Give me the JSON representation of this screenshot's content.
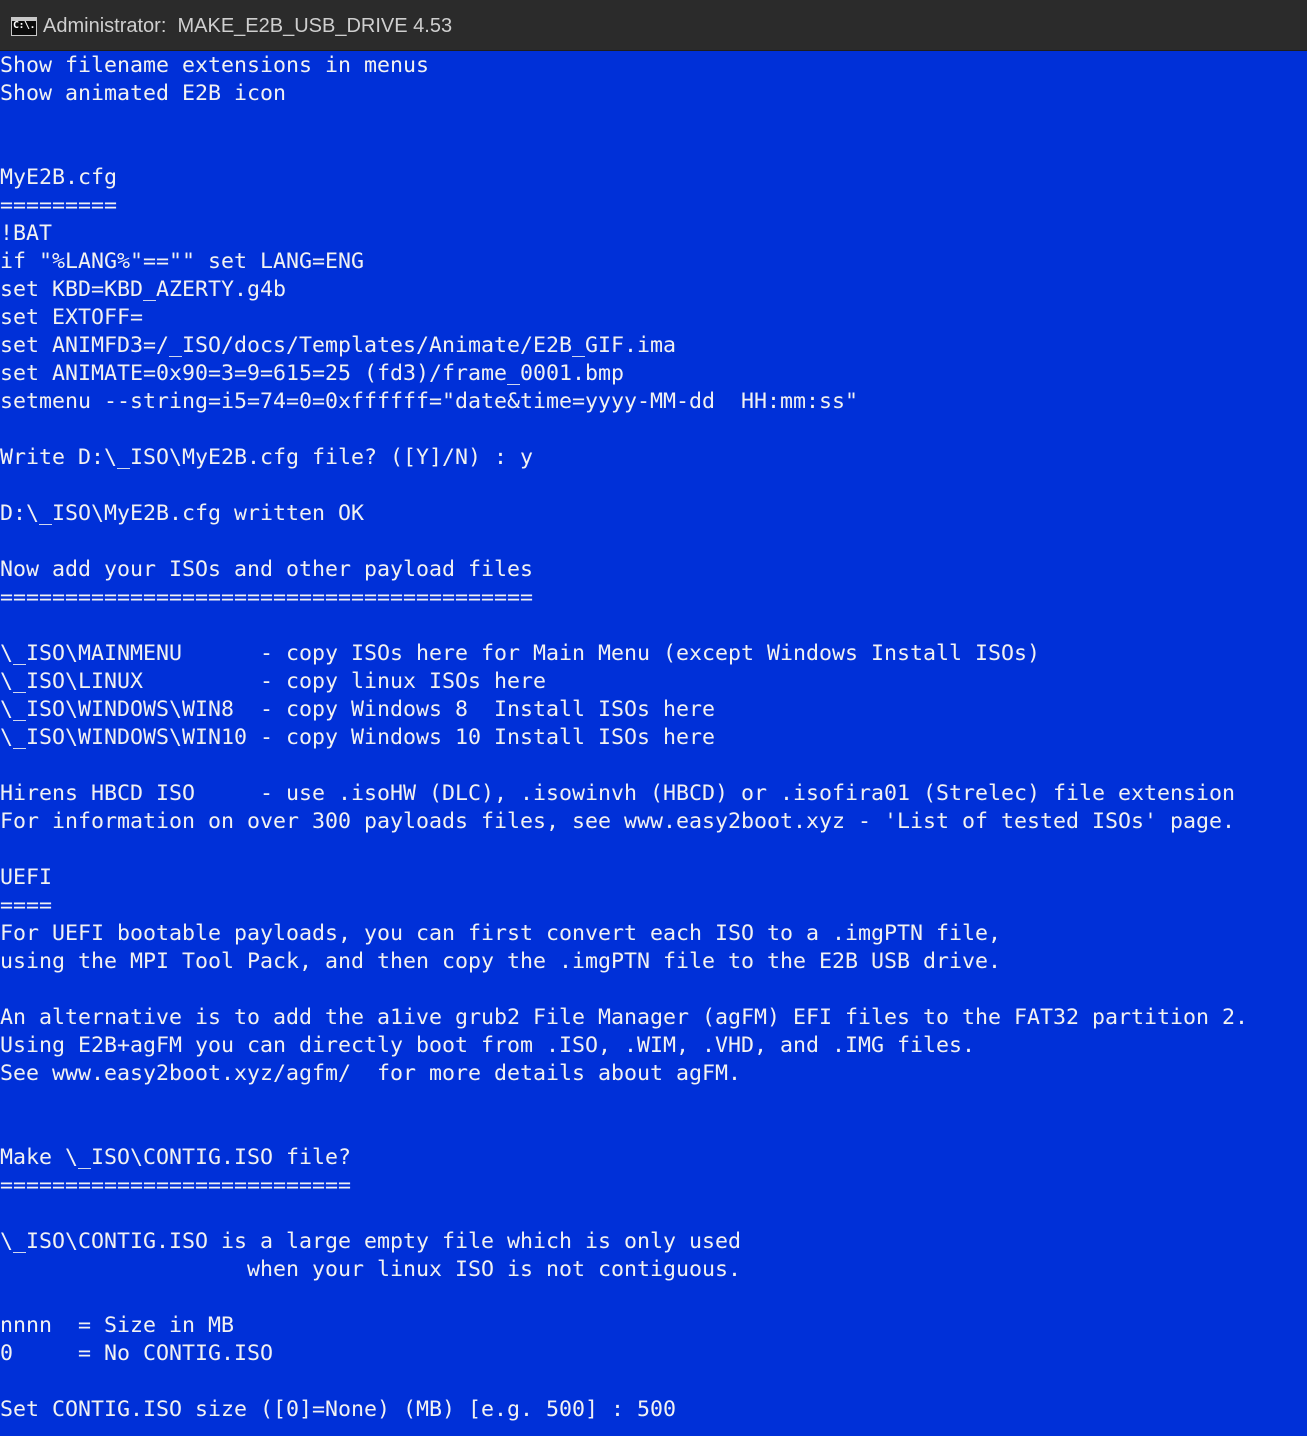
{
  "window": {
    "title": "Administrator:  MAKE_E2B_USB_DRIVE 4.53",
    "icon": "cmd-icon",
    "icon_text": "C:\\."
  },
  "colors": {
    "background": "#0030d8",
    "text": "#f2f2f2",
    "titlebar": "#2b2b2b"
  },
  "console": {
    "lines": [
      "Show filename extensions in menus",
      "Show animated E2B icon",
      "",
      "",
      "MyE2B.cfg",
      "=========",
      "!BAT",
      "if \"%LANG%\"==\"\" set LANG=ENG",
      "set KBD=KBD_AZERTY.g4b",
      "set EXTOFF=",
      "set ANIMFD3=/_ISO/docs/Templates/Animate/E2B_GIF.ima",
      "set ANIMATE=0x90=3=9=615=25 (fd3)/frame_0001.bmp",
      "setmenu --string=i5=74=0=0xffffff=\"date&time=yyyy-MM-dd  HH:mm:ss\"",
      "",
      "Write D:\\_ISO\\MyE2B.cfg file? ([Y]/N) : y",
      "",
      "D:\\_ISO\\MyE2B.cfg written OK",
      "",
      "Now add your ISOs and other payload files",
      "=========================================",
      "",
      "\\_ISO\\MAINMENU      - copy ISOs here for Main Menu (except Windows Install ISOs)",
      "\\_ISO\\LINUX         - copy linux ISOs here",
      "\\_ISO\\WINDOWS\\WIN8  - copy Windows 8  Install ISOs here",
      "\\_ISO\\WINDOWS\\WIN10 - copy Windows 10 Install ISOs here",
      "",
      "Hirens HBCD ISO     - use .isoHW (DLC), .isowinvh (HBCD) or .isofira01 (Strelec) file extension",
      "For information on over 300 payloads files, see www.easy2boot.xyz - 'List of tested ISOs' page.",
      "",
      "UEFI",
      "====",
      "For UEFI bootable payloads, you can first convert each ISO to a .imgPTN file,",
      "using the MPI Tool Pack, and then copy the .imgPTN file to the E2B USB drive.",
      "",
      "An alternative is to add the a1ive grub2 File Manager (agFM) EFI files to the FAT32 partition 2.",
      "Using E2B+agFM you can directly boot from .ISO, .WIM, .VHD, and .IMG files.",
      "See www.easy2boot.xyz/agfm/  for more details about agFM.",
      "",
      "",
      "Make \\_ISO\\CONTIG.ISO file?",
      "===========================",
      "",
      "\\_ISO\\CONTIG.ISO is a large empty file which is only used",
      "                   when your linux ISO is not contiguous.",
      "",
      "nnnn  = Size in MB",
      "0     = No CONTIG.ISO",
      "",
      "Set CONTIG.ISO size ([0]=None) (MB) [e.g. 500] : 500"
    ]
  }
}
